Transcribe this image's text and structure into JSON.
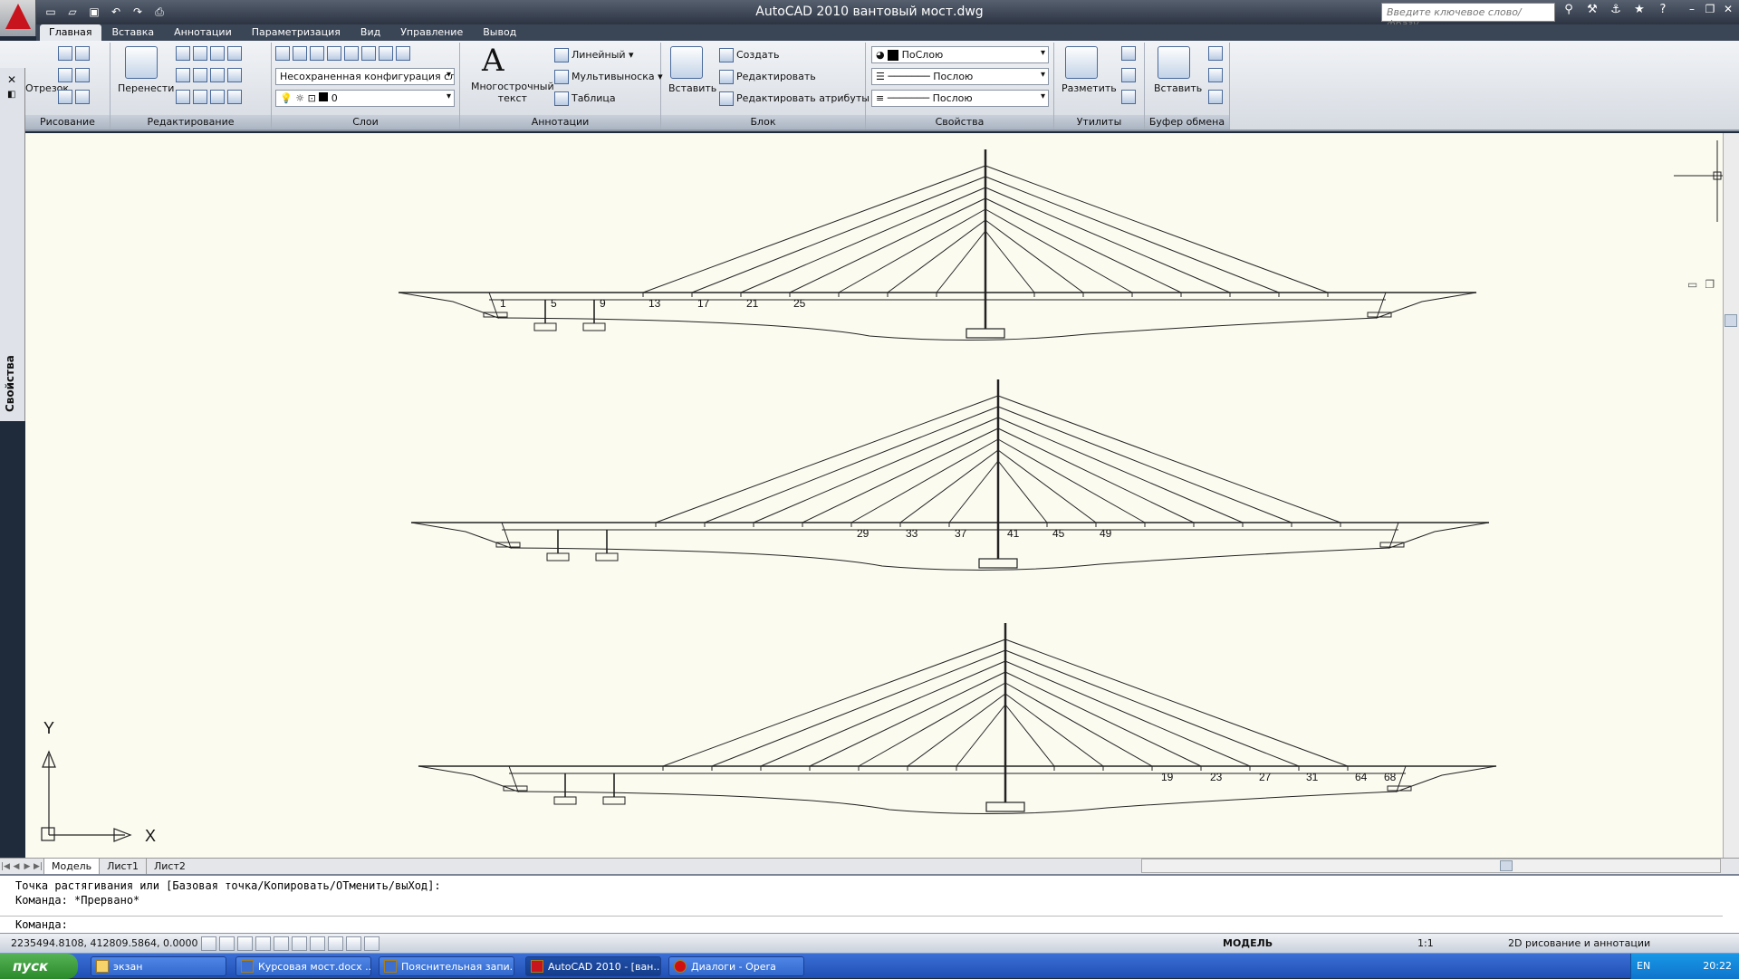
{
  "window": {
    "title": "AutoCAD 2010    вантовый мост.dwg",
    "search_placeholder": "Введите ключевое слово/фразу"
  },
  "tabs": [
    "Главная",
    "Вставка",
    "Аннотации",
    "Параметризация",
    "Вид",
    "Управление",
    "Вывод"
  ],
  "ribbon": {
    "draw": {
      "title": "Рисование",
      "otrezok": "Отрезок"
    },
    "edit": {
      "title": "Редактирование",
      "move": "Перенести"
    },
    "layers": {
      "title": "Слои",
      "config": "Несохраненная конфигурация слоев",
      "layer_current": "0"
    },
    "annotations": {
      "title": "Аннотации",
      "mtext_line1": "Многострочный",
      "mtext_line2": "текст",
      "linear": "Линейный",
      "multileader": "Мультивыноска",
      "table": "Таблица"
    },
    "block": {
      "title": "Блок",
      "insert": "Вставить",
      "create": "Создать",
      "edit": "Редактировать",
      "edit_attr": "Редактировать атрибуты"
    },
    "properties": {
      "title": "Свойства",
      "color": "ПоСлою",
      "linetype": "Послою",
      "lineweight": "Послою"
    },
    "utilities": {
      "title": "Утилиты",
      "measure": "Разметить"
    },
    "clipboard": {
      "title": "Буфер обмена",
      "paste": "Вставить"
    }
  },
  "palette": {
    "label": "Свойства"
  },
  "drawing": {
    "bridge1_labels": [
      "1",
      "5",
      "9",
      "13",
      "17",
      "21",
      "25"
    ],
    "bridge2_labels": [
      "29",
      "33",
      "37",
      "41",
      "45",
      "49"
    ],
    "bridge3_labels": [
      "19",
      "23",
      "27",
      "31",
      "64",
      "68"
    ],
    "ucs_x": "X",
    "ucs_y": "Y"
  },
  "layout_tabs": [
    "Модель",
    "Лист1",
    "Лист2"
  ],
  "command": {
    "line1": "Точка растягивания или [Базовая точка/Копировать/ОТменить/выХод]:",
    "line2": "Команда: *Прервано*",
    "line3": "Команда:"
  },
  "status": {
    "coords": "2235494.8108, 412809.5864, 0.0000",
    "model": "МОДЕЛЬ",
    "scale": "1:1",
    "workspace": "2D рисование и аннотации"
  },
  "taskbar": {
    "start": "пуск",
    "items": [
      "экзан",
      "Курсовая мост.docx ...",
      "Пояснительная запи...",
      "AutoCAD 2010 - [ван...",
      "Диалоги - Opera"
    ],
    "lang": "EN",
    "clock": "20:22"
  }
}
